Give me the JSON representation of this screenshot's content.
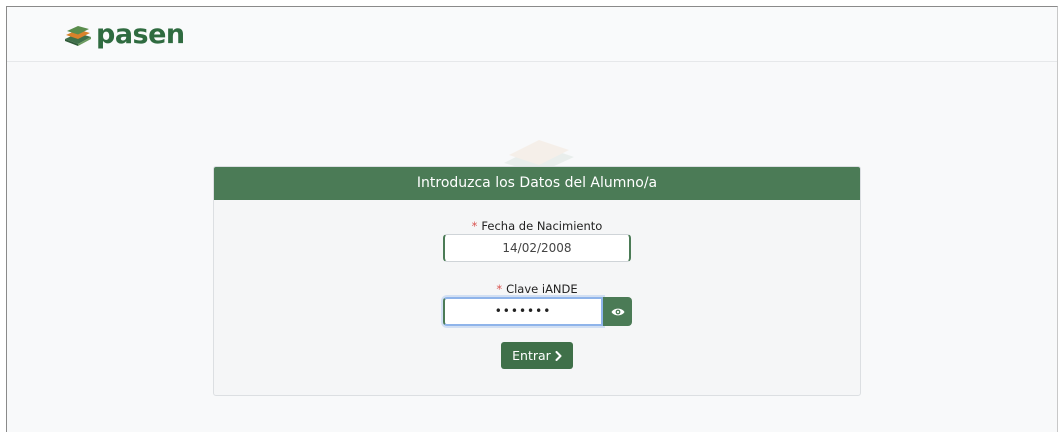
{
  "app": {
    "logo_text": "pasen"
  },
  "form": {
    "title": "Introduzca los Datos del Alumno/a",
    "required_marker": "*",
    "birthdate": {
      "label": "Fecha de Nacimiento",
      "value": "14/02/2008"
    },
    "password": {
      "label": "Clave iANDE",
      "value": "•••••••"
    },
    "submit_label": "Entrar",
    "submit_icon": "chevron-right-icon",
    "reveal_icon": "eye-icon"
  },
  "colors": {
    "primary": "#4b7b56",
    "brand": "#2f6b40",
    "required": "#d9534f",
    "focus": "#8fb4ea"
  }
}
